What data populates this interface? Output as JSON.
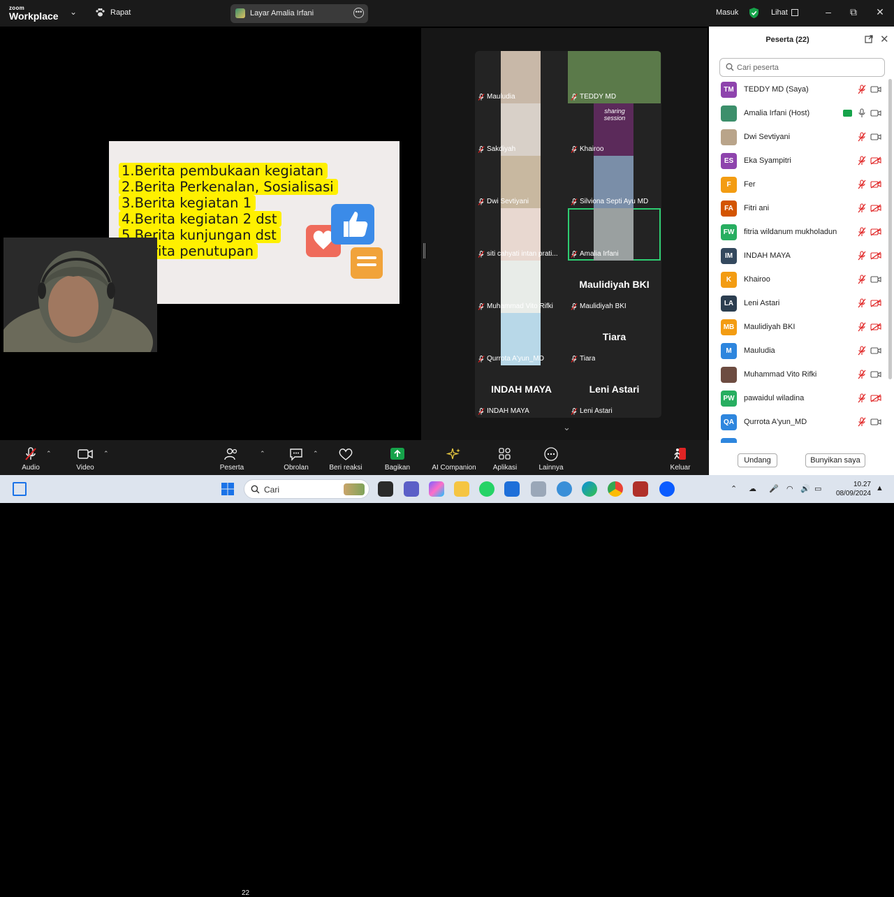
{
  "titlebar": {
    "brand_small": "zoom",
    "brand_big": "Workplace",
    "meeting_label": "Rapat",
    "share_label": "Layar Amalia Irfani",
    "signin_label": "Masuk",
    "view_label": "Lihat"
  },
  "slide": {
    "lines": [
      "1.Berita pembukaan kegiatan",
      "2.Berita Perkenalan, Sosialisasi",
      "3.Berita kegiatan 1",
      "4.Berita kegiatan 2 dst",
      "5.Berita kunjungan dst",
      "6.Berita penutupan"
    ]
  },
  "gallery": {
    "tiles": [
      {
        "name": "Mauludia",
        "big": ""
      },
      {
        "name": "TEDDY MD",
        "big": ""
      },
      {
        "name": "Sakdiyah",
        "big": ""
      },
      {
        "name": "Khairoo",
        "big": ""
      },
      {
        "name": "Dwi Sevtiyani",
        "big": ""
      },
      {
        "name": "Silviona Septi Ayu MD",
        "big": ""
      },
      {
        "name": "siti cahyati intan prati...",
        "big": ""
      },
      {
        "name": "Amalia Irfani",
        "big": ""
      },
      {
        "name": "Muhammad Vito Rifki",
        "big": ""
      },
      {
        "name": "Maulidiyah BKI",
        "big": "Maulidiyah BKI"
      },
      {
        "name": "Qurrota A'yun_MD",
        "big": ""
      },
      {
        "name": "Tiara",
        "big": "Tiara"
      },
      {
        "name": "INDAH MAYA",
        "big": "INDAH MAYA"
      },
      {
        "name": "Leni Astari",
        "big": "Leni Astari"
      }
    ],
    "thumb_text": "sharing session"
  },
  "panel": {
    "title": "Peserta (22)",
    "search_placeholder": "Cari peserta",
    "mute_all_label": "Undang",
    "unmute_label": "Bunyikan saya",
    "participants": [
      {
        "initials": "TM",
        "name": "TEDDY MD (Saya)",
        "color": "#8e44ad",
        "cam_on": true
      },
      {
        "initials": "",
        "name": "Amalia Irfani (Host)",
        "color": "#3c8f6b",
        "cam_on": true
      },
      {
        "initials": "",
        "name": "Dwi Sevtiyani",
        "color": "#b9a48a",
        "cam_on": true
      },
      {
        "initials": "ES",
        "name": "Eka Syampitri",
        "color": "#8e44ad",
        "cam_on": false
      },
      {
        "initials": "F",
        "name": "Fer",
        "color": "#f39c12",
        "cam_on": false
      },
      {
        "initials": "FA",
        "name": "Fitri ani",
        "color": "#d35400",
        "cam_on": false
      },
      {
        "initials": "FW",
        "name": "fitria wildanum mukholadun",
        "color": "#27ae60",
        "cam_on": false
      },
      {
        "initials": "IM",
        "name": "INDAH MAYA",
        "color": "#34495e",
        "cam_on": false
      },
      {
        "initials": "K",
        "name": "Khairoo",
        "color": "#f39c12",
        "cam_on": true
      },
      {
        "initials": "LA",
        "name": "Leni Astari",
        "color": "#2c3e50",
        "cam_on": false
      },
      {
        "initials": "MB",
        "name": "Maulidiyah BKI",
        "color": "#f39c12",
        "cam_on": false
      },
      {
        "initials": "M",
        "name": "Mauludia",
        "color": "#2e86de",
        "cam_on": true
      },
      {
        "initials": "",
        "name": "Muhammad Vito Rifki",
        "color": "#6d4c41",
        "cam_on": true
      },
      {
        "initials": "PW",
        "name": "pawaidul wiladina",
        "color": "#27ae60",
        "cam_on": false
      },
      {
        "initials": "QA",
        "name": "Qurrota A'yun_MD",
        "color": "#2e86de",
        "cam_on": true
      }
    ]
  },
  "toolbar": {
    "audio": "Audio",
    "video": "Video",
    "participants": "Peserta",
    "participants_count": "22",
    "chat": "Obrolan",
    "react": "Beri reaksi",
    "share": "Bagikan",
    "ai": "AI Companion",
    "apps": "Aplikasi",
    "more": "Lainnya",
    "leave": "Keluar"
  },
  "taskbar": {
    "search_label": "Cari",
    "time": "10.27",
    "date": "08/09/2024"
  },
  "colors": {
    "highlight": "#fff000",
    "active_speaker": "#2ecc71",
    "share_green": "#16a34a",
    "leave_red": "#e02424"
  }
}
